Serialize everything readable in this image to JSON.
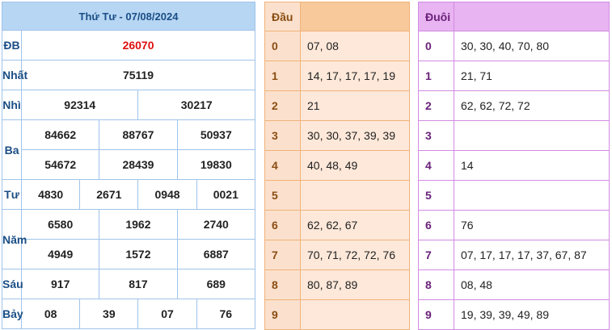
{
  "results": {
    "header": "Thứ Tư - 07/08/2024",
    "prizes": [
      {
        "label": "ĐB",
        "rows": [
          [
            "26070"
          ]
        ]
      },
      {
        "label": "Nhất",
        "rows": [
          [
            "75119"
          ]
        ]
      },
      {
        "label": "Nhì",
        "rows": [
          [
            "92314",
            "30217"
          ]
        ]
      },
      {
        "label": "Ba",
        "rows": [
          [
            "84662",
            "88767",
            "50937"
          ],
          [
            "54672",
            "28439",
            "19830"
          ]
        ]
      },
      {
        "label": "Tư",
        "rows": [
          [
            "4830",
            "2671",
            "0948",
            "0021"
          ]
        ]
      },
      {
        "label": "Năm",
        "rows": [
          [
            "6580",
            "1962",
            "2740"
          ],
          [
            "4949",
            "1572",
            "6887"
          ]
        ]
      },
      {
        "label": "Sáu",
        "rows": [
          [
            "917",
            "817",
            "689"
          ]
        ]
      },
      {
        "label": "Bảy",
        "rows": [
          [
            "08",
            "39",
            "07",
            "76"
          ]
        ]
      }
    ]
  },
  "dau": {
    "header": "Đầu",
    "rows": [
      {
        "digit": "0",
        "values": "07, 08"
      },
      {
        "digit": "1",
        "values": "14, 17, 17, 17, 19"
      },
      {
        "digit": "2",
        "values": "21"
      },
      {
        "digit": "3",
        "values": "30, 30, 37, 39, 39"
      },
      {
        "digit": "4",
        "values": "40, 48, 49"
      },
      {
        "digit": "5",
        "values": ""
      },
      {
        "digit": "6",
        "values": "62, 62, 67"
      },
      {
        "digit": "7",
        "values": "70, 71, 72, 72, 76"
      },
      {
        "digit": "8",
        "values": "80, 87, 89"
      },
      {
        "digit": "9",
        "values": ""
      }
    ]
  },
  "duoi": {
    "header": "Đuôi",
    "rows": [
      {
        "digit": "0",
        "values": "30, 30, 40, 70, 80"
      },
      {
        "digit": "1",
        "values": "21, 71"
      },
      {
        "digit": "2",
        "values": "62, 62, 72, 72"
      },
      {
        "digit": "3",
        "values": ""
      },
      {
        "digit": "4",
        "values": "14"
      },
      {
        "digit": "5",
        "values": ""
      },
      {
        "digit": "6",
        "values": "76"
      },
      {
        "digit": "7",
        "values": "07, 17, 17, 17, 37, 67, 87"
      },
      {
        "digit": "8",
        "values": "08, 48"
      },
      {
        "digit": "9",
        "values": "19, 39, 39, 49, 89"
      }
    ]
  },
  "colors": {
    "special_prize": "#e01010",
    "main_border": "#9fc4ea",
    "dau_accent": "#f7c99b",
    "duoi_accent": "#e8b4f1"
  }
}
